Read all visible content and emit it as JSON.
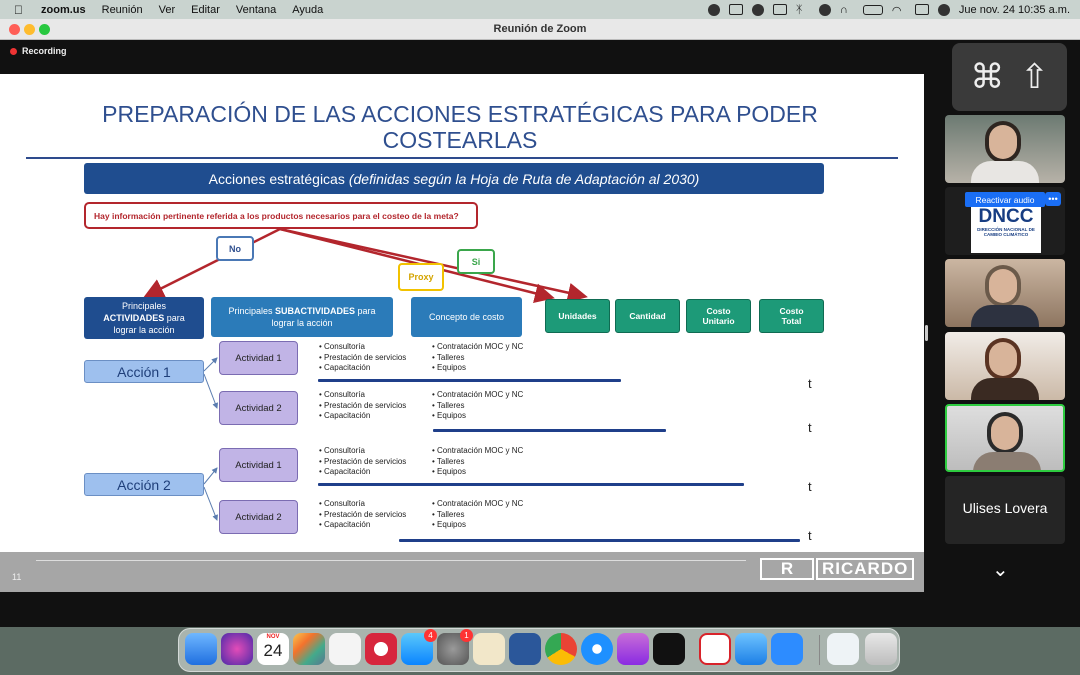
{
  "menubar": {
    "app_name": "zoom.us",
    "menus": [
      "Reunión",
      "Ver",
      "Editar",
      "Ventana",
      "Ayuda"
    ],
    "datetime": "Jue nov. 24  10:35 a.m."
  },
  "window": {
    "title": "Reunión de Zoom",
    "recording_label": "Recording"
  },
  "slide": {
    "title": "PREPARACIÓN DE LAS ACCIONES ESTRATÉGICAS PARA PODER\nCOSTEARLAS",
    "banner": "Acciones estratégicas",
    "banner_em": "(definidas según la Hoja de Ruta de Adaptación al 2030)",
    "question": "Hay información pertinente referida a los productos necesarios para el costeo de la meta?",
    "tag_no": "No",
    "tag_si": "Si",
    "tag_proxy": "Proxy",
    "hdr_principales_1": "Principales",
    "hdr_principales_2": "ACTIVIDADES",
    "hdr_principales_3": "para",
    "hdr_principales_4": "lograr la acción",
    "hdr_sub_1": "Principales",
    "hdr_sub_2": "SUBACTIVIDADES",
    "hdr_sub_3": "para",
    "hdr_sub_4": "lograr la acción",
    "hdr_concepto": "Concepto de costo",
    "cost_unidades": "Unidades",
    "cost_cantidad": "Cantidad",
    "cost_unitario_1": "Costo",
    "cost_unitario_2": "Unitario",
    "cost_total_1": "Costo",
    "cost_total_2": "Total",
    "accion_1": "Acción 1",
    "accion_2": "Acción 2",
    "actividad_1": "Actividad 1",
    "actividad_2": "Actividad 2",
    "sub_items": [
      "Consultoría",
      "Prestación de servicios",
      "Capacitación"
    ],
    "concept_items": [
      "Contratación MOC y NC",
      "Talleres",
      "Equipos"
    ],
    "t_mark": "t",
    "page_number": "11",
    "logo_text": "RICARDO"
  },
  "panel": {
    "shortcut_symbols": [
      "⌘",
      "⇧"
    ],
    "reactivar_audio": "Reactivar audio",
    "more_label": "•••",
    "dncc_big": "DNCC",
    "dncc_small": "DIRECCIÓN NACIONAL DE CAMBIO CLIMÁTICO",
    "participant_name": "Ulises Lovera",
    "scroll_icon": "chevron-down-icon"
  },
  "dock": {
    "calendar_month": "NOV",
    "calendar_day": "24",
    "appstore_badge": "4",
    "settings_badge": "1"
  }
}
